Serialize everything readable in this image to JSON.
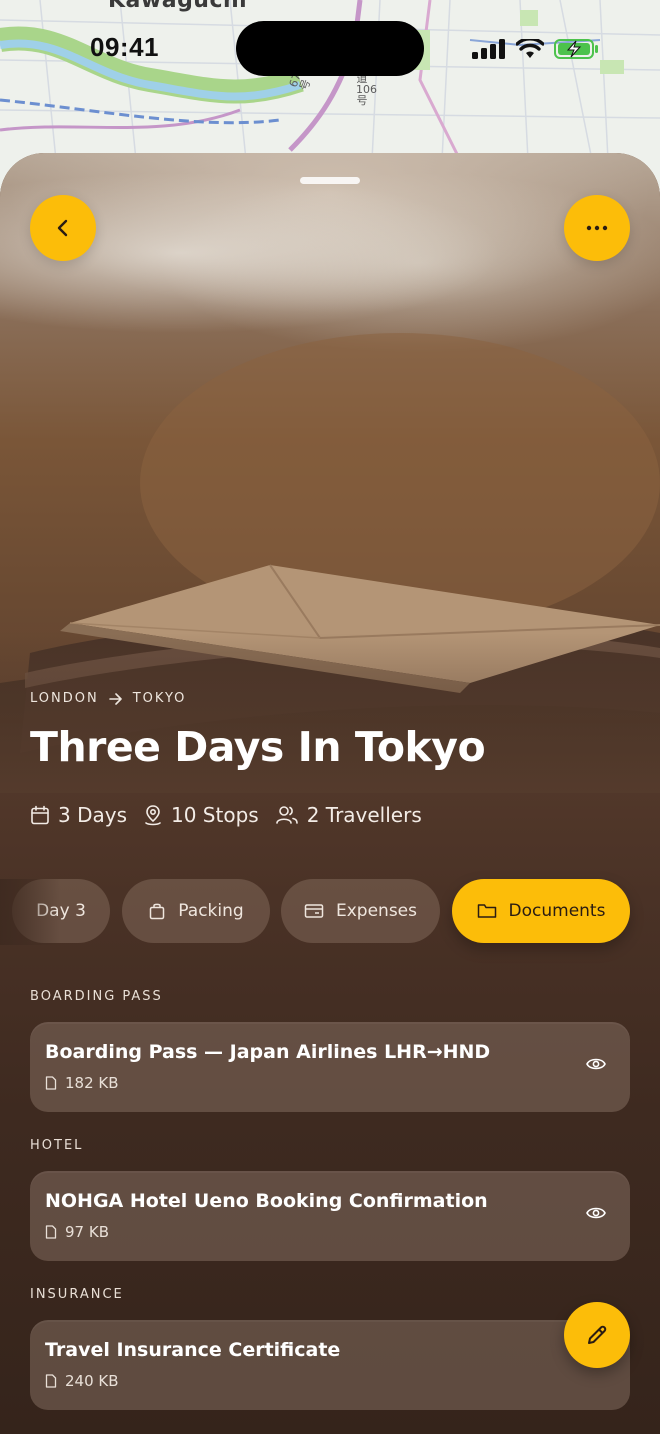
{
  "map": {
    "city_label": "Kawaguchi",
    "road_label_a": "都道106号",
    "road_label_b": "67号"
  },
  "status_bar": {
    "time": "09:41"
  },
  "trip": {
    "origin": "LONDON",
    "destination": "TOKYO",
    "title": "Three Days In Tokyo",
    "days": "3 Days",
    "stops": "10 Stops",
    "travellers": "2 Travellers"
  },
  "tabs": [
    {
      "label": "Day 3",
      "icon": "none"
    },
    {
      "label": "Packing",
      "icon": "bag-icon"
    },
    {
      "label": "Expenses",
      "icon": "card-icon"
    },
    {
      "label": "Documents",
      "icon": "folder-icon",
      "active": true
    }
  ],
  "documents": [
    {
      "section": "BOARDING PASS",
      "title": "Boarding Pass — Japan Airlines LHR→HND",
      "size": "182 KB"
    },
    {
      "section": "HOTEL",
      "title": "NOHGA Hotel Ueno Booking Confirmation",
      "size": "97 KB"
    },
    {
      "section": "INSURANCE",
      "title": "Travel Insurance Certificate",
      "size": "240 KB"
    }
  ],
  "colors": {
    "accent": "#fcbd09",
    "sheet_brown": "#4a3226"
  }
}
